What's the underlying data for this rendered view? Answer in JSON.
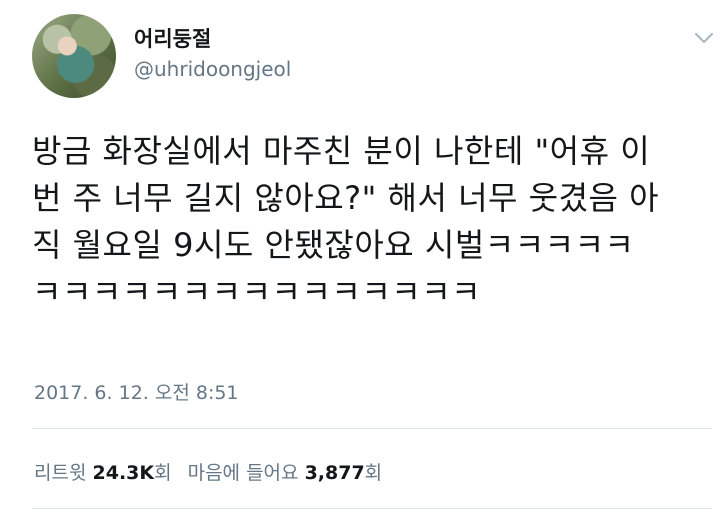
{
  "user": {
    "display_name": "어리둥절",
    "handle": "@uhridoongjeol"
  },
  "tweet": {
    "lines": [
      "방금 화장실에서 마주친 분이 나한테 \"어휴 이",
      "번 주 너무 길지 않아요?\" 해서 너무 웃겼음 아",
      "직 월요일 9시도 안됐잖아요 시벌ㅋㅋㅋㅋㅋ",
      "ㅋㅋㅋㅋㅋㅋㅋㅋㅋㅋㅋㅋㅋㅋㅋ"
    ],
    "timestamp": "2017. 6. 12. 오전 8:51"
  },
  "stats": {
    "retweet_label": "리트윗",
    "retweet_count": "24.3K",
    "retweet_suffix": "회",
    "like_label": "마음에 들어요",
    "like_count": "3,877",
    "like_suffix": "회"
  },
  "icons": {
    "menu": "chevron-down-icon",
    "profile": "avatar"
  },
  "colors": {
    "text": "#14171a",
    "secondary": "#657786",
    "divider": "#e1e8ed"
  }
}
